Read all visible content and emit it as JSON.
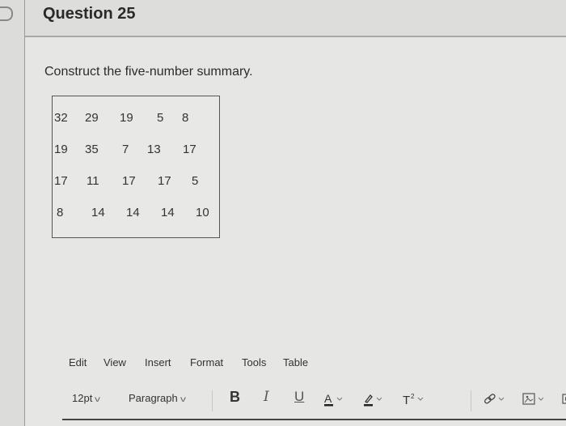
{
  "question": {
    "title": "Question 25",
    "prompt": "Construct the five-number summary."
  },
  "data_table": {
    "rows": [
      [
        "32",
        "29",
        "19",
        "5",
        "8"
      ],
      [
        "19",
        "35",
        "7",
        "13",
        "17"
      ],
      [
        "17",
        "11",
        "17",
        "17",
        "5"
      ],
      [
        "8",
        "14",
        "14",
        "14",
        "10"
      ]
    ]
  },
  "editor": {
    "menu": [
      "Edit",
      "View",
      "Insert",
      "Format",
      "Tools",
      "Table"
    ],
    "toolbar": {
      "font_size": "12pt",
      "block_format": "Paragraph",
      "bold": "B",
      "italic": "I",
      "underline": "U",
      "text_color_icon": "text-color-icon",
      "highlight_icon": "highlight-icon",
      "superscript_icon": "superscript-icon",
      "link_icon": "link-icon",
      "image_icon": "image-icon",
      "media_icon": "media-icon"
    }
  }
}
